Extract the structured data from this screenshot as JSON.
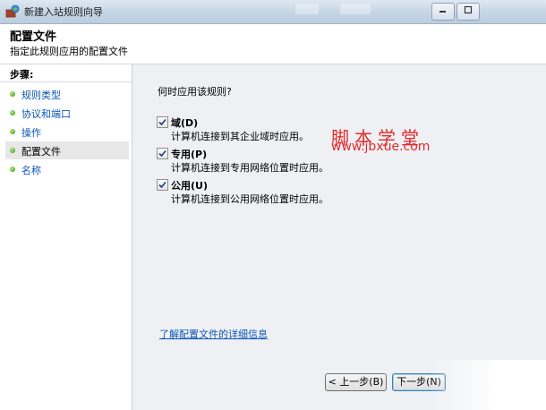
{
  "window": {
    "title": "新建入站规则向导"
  },
  "header": {
    "title": "配置文件",
    "subtitle": "指定此规则应用的配置文件"
  },
  "steps": {
    "heading": "步骤:",
    "items": [
      {
        "label": "规则类型"
      },
      {
        "label": "协议和端口"
      },
      {
        "label": "操作"
      },
      {
        "label": "配置文件"
      },
      {
        "label": "名称"
      }
    ]
  },
  "content": {
    "question": "何时应用该规则?",
    "options": [
      {
        "label": "域(D)",
        "description": "计算机连接到其企业域时应用。",
        "checked": true
      },
      {
        "label": "专用(P)",
        "description": "计算机连接到专用网络位置时应用。",
        "checked": true
      },
      {
        "label": "公用(U)",
        "description": "计算机连接到公用网络位置时应用。",
        "checked": true
      }
    ],
    "learn_more": "了解配置文件的详细信息"
  },
  "watermark": {
    "name": "脚本学堂",
    "url": "www.jbxue.com"
  },
  "buttons": {
    "back": "< 上一步(B)",
    "next": "下一步(N)"
  },
  "colors": {
    "link": "#0b56b5",
    "watermark": "#e22b2b",
    "content_bg": "#eef0f4"
  }
}
